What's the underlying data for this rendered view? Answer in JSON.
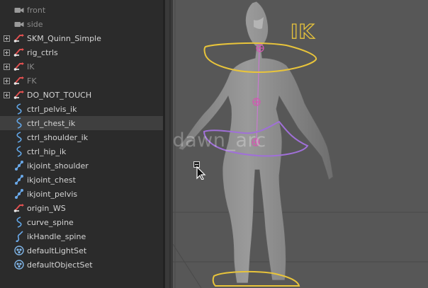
{
  "outliner": {
    "items": [
      {
        "label": "front",
        "type": "camera",
        "dim": true,
        "expandable": false,
        "selected": false
      },
      {
        "label": "side",
        "type": "camera",
        "dim": true,
        "expandable": false,
        "selected": false
      },
      {
        "label": "SKM_Quinn_Simple",
        "type": "transform",
        "dim": false,
        "expandable": true,
        "selected": false
      },
      {
        "label": "rig_ctrls",
        "type": "transform",
        "dim": false,
        "expandable": true,
        "selected": false
      },
      {
        "label": "IK",
        "type": "transform",
        "dim": true,
        "expandable": true,
        "selected": false
      },
      {
        "label": "FK",
        "type": "transform",
        "dim": true,
        "expandable": true,
        "selected": false
      },
      {
        "label": "DO_NOT_TOUCH",
        "type": "transform",
        "dim": false,
        "expandable": true,
        "selected": false
      },
      {
        "label": "ctrl_pelvis_ik",
        "type": "curve",
        "dim": false,
        "expandable": false,
        "selected": false
      },
      {
        "label": "ctrl_chest_ik",
        "type": "curve",
        "dim": false,
        "expandable": false,
        "selected": true
      },
      {
        "label": "ctrl_shoulder_ik",
        "type": "curve",
        "dim": false,
        "expandable": false,
        "selected": false
      },
      {
        "label": "ctrl_hip_ik",
        "type": "curve",
        "dim": false,
        "expandable": false,
        "selected": false
      },
      {
        "label": "ikjoint_shoulder",
        "type": "joint",
        "dim": false,
        "expandable": false,
        "selected": false
      },
      {
        "label": "ikjoint_chest",
        "type": "joint",
        "dim": false,
        "expandable": false,
        "selected": false
      },
      {
        "label": "ikjoint_pelvis",
        "type": "joint",
        "dim": false,
        "expandable": false,
        "selected": false
      },
      {
        "label": "origin_WS",
        "type": "transform",
        "dim": false,
        "expandable": false,
        "selected": false
      },
      {
        "label": "curve_spine",
        "type": "curve",
        "dim": false,
        "expandable": false,
        "selected": false
      },
      {
        "label": "ikHandle_spine",
        "type": "ikhandle",
        "dim": false,
        "expandable": false,
        "selected": false
      },
      {
        "label": "defaultLightSet",
        "type": "set",
        "dim": false,
        "expandable": false,
        "selected": false
      },
      {
        "label": "defaultObjectSet",
        "type": "set",
        "dim": false,
        "expandable": false,
        "selected": false
      }
    ]
  },
  "viewport": {
    "ik_label": "IK",
    "watermark": "@dawn_arc",
    "colors": {
      "ik_ctrl": "#e8c43b",
      "hip_ctrl": "#a070d8",
      "joint": "#d05ab0",
      "mesh": "#8d8d8d",
      "background": "#575757"
    }
  }
}
